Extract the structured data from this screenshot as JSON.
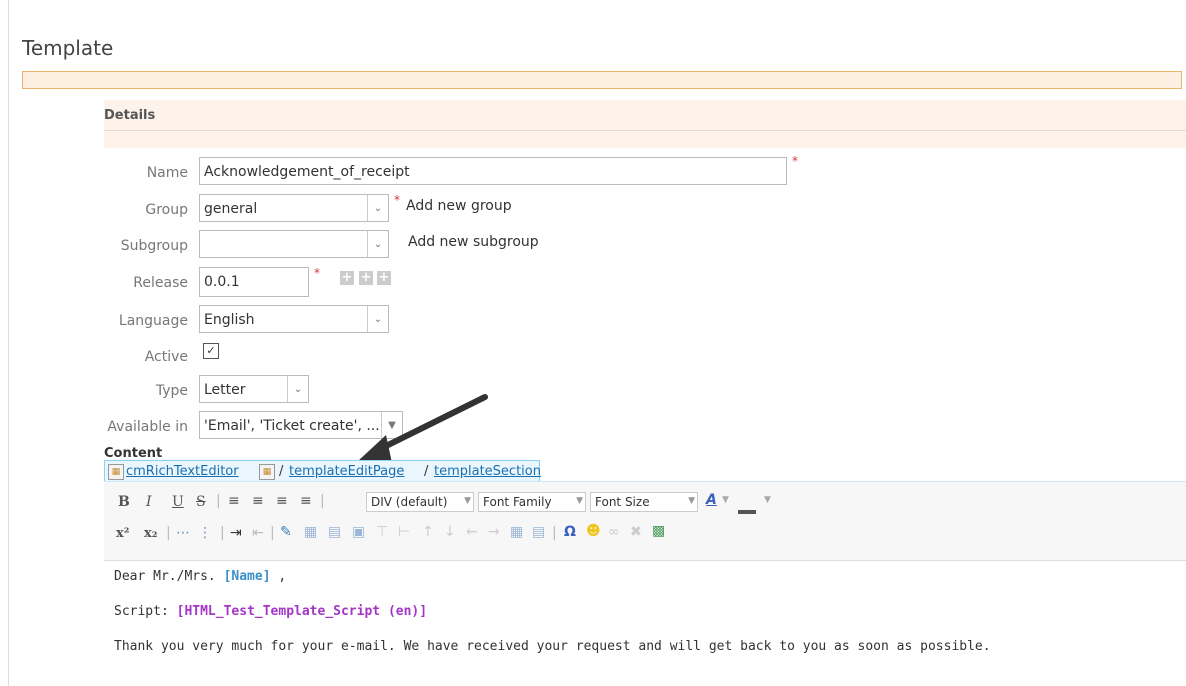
{
  "page": {
    "title": "Template"
  },
  "details": {
    "header": "Details"
  },
  "form": {
    "name": {
      "label": "Name",
      "value": "Acknowledgement_of_receipt"
    },
    "group": {
      "label": "Group",
      "value": "general",
      "add_link": "Add new group"
    },
    "subgroup": {
      "label": "Subgroup",
      "value": "",
      "add_link": "Add new subgroup"
    },
    "release": {
      "label": "Release",
      "value": "0.0.1"
    },
    "language": {
      "label": "Language",
      "value": "English"
    },
    "active": {
      "label": "Active",
      "checked": true
    },
    "type": {
      "label": "Type",
      "value": "Letter"
    },
    "available": {
      "label": "Available in",
      "value": "'Email', 'Ticket create', ..."
    },
    "required_mark": "*"
  },
  "content_label": "Content",
  "editor": {
    "breadcrumb": {
      "editor": "cmRichTextEditor",
      "sep": "/",
      "page": "templateEditPage",
      "section": "templateSection"
    },
    "toolbar": {
      "bold": "B",
      "italic": "I",
      "underline": "U",
      "strike": "S",
      "format": "DIV (default)",
      "font_family": "Font Family",
      "font_size": "Font Size",
      "superscript": "x²",
      "subscript": "x₂",
      "omega": "Ω"
    },
    "body": {
      "line1_prefix": "Dear Mr./Mrs. ",
      "line1_tag": "[Name]",
      "line1_suffix": " ,",
      "line2_prefix": "Script: ",
      "line2_tag": "[HTML_Test_Template_Script (en)]",
      "line3": "Thank you very much for your e-mail. We have received your request and will get back to you as soon as possible."
    }
  },
  "colors": {
    "accent_orange": "#f0b56a",
    "link_blue": "#1a6fb0",
    "tag_blue": "#3a8fc5",
    "tag_purple": "#a335c7",
    "required_red": "#d33333"
  }
}
